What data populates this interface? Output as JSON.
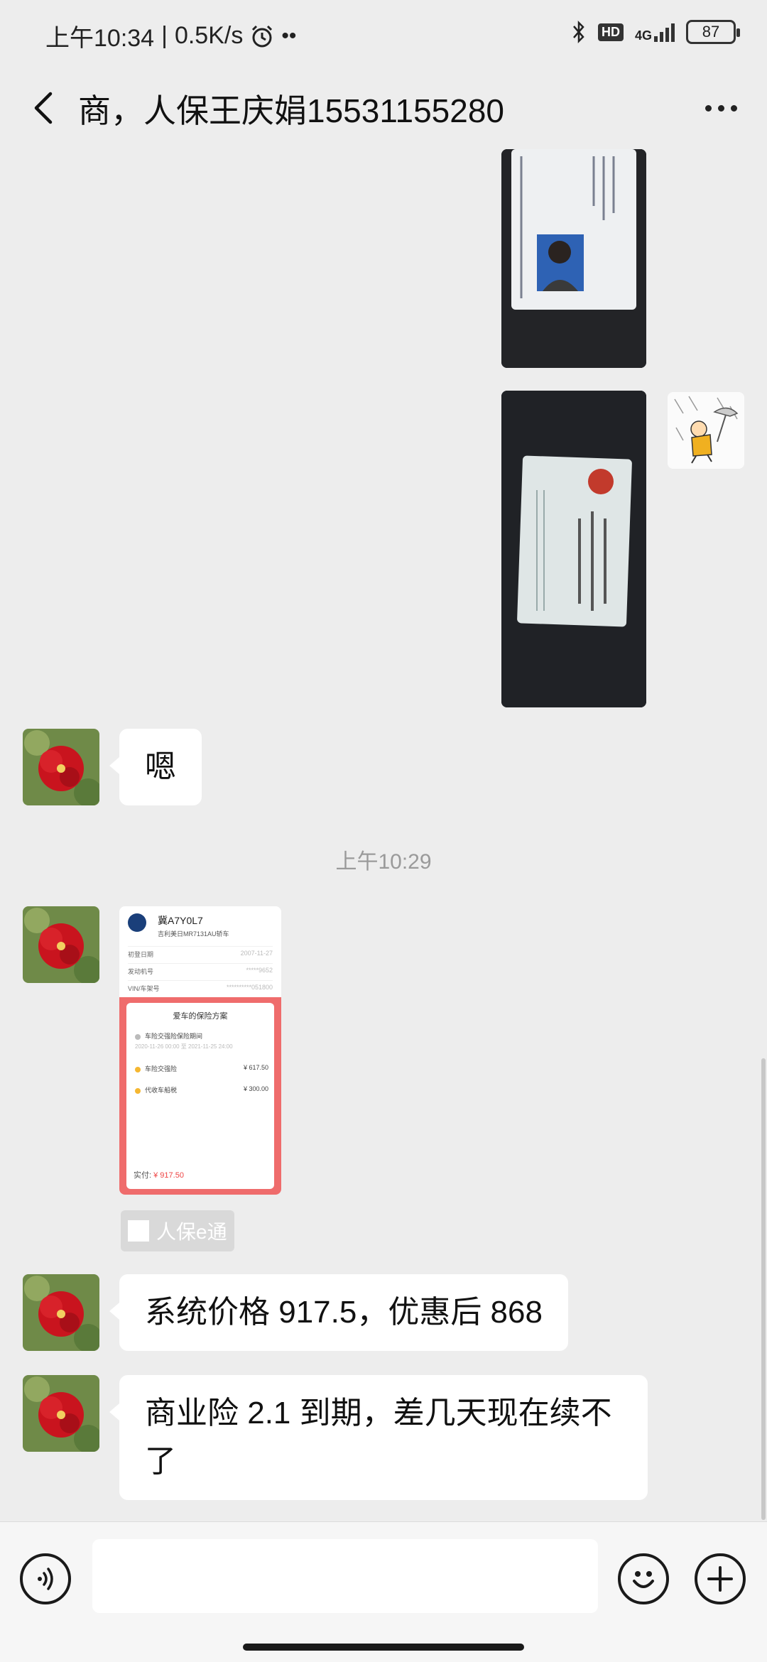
{
  "status_bar": {
    "time": "上午10:34",
    "net_speed": "0.5K/s",
    "icons": [
      "alarm-icon",
      "bluetooth-icon",
      "hd-icon",
      "signal-4g-icon",
      "battery-icon"
    ],
    "hd_badge": "HD",
    "network": "4G",
    "battery": "87"
  },
  "header": {
    "title": "商，人保王庆娟15531155280",
    "back_icon": "chevron-left-icon",
    "more_icon": "more-dots-icon"
  },
  "messages": {
    "reply_1": "嗯",
    "timestamp": "上午10:29",
    "card": {
      "plate": "冀A7Y0L7",
      "model": "吉利美日MR7131AU轿车",
      "reg_label": "初登日期",
      "reg_value": "2007-11-27",
      "engine_label": "发动机号",
      "engine_value": "*****9652",
      "vin_label": "VIN/车架号",
      "vin_value": "**********051800",
      "plan_title": "爱车的保险方案",
      "period_label": "车险交强险保险期间",
      "period_value": "2020-11-26 00:00 至 2021-11-25 24:00",
      "item1_label": "车险交强险",
      "item1_value": "¥ 617.50",
      "item2_label": "代收车船税",
      "item2_value": "¥ 300.00",
      "pay_label": "实付:",
      "pay_value": "¥ 917.50"
    },
    "mini_program": "人保e通",
    "reply_2": "系统价格 917.5，优惠后 868",
    "reply_3_line1": "商业险 2.1 到期，差几天现在续不",
    "reply_3_line2": "了"
  },
  "input_bar": {
    "voice_icon": "voice-icon",
    "emoji_icon": "emoji-icon",
    "plus_icon": "plus-icon",
    "placeholder": ""
  },
  "colors": {
    "background": "#ededed",
    "bubble": "#ffffff",
    "card_red": "#ef6c6c"
  }
}
